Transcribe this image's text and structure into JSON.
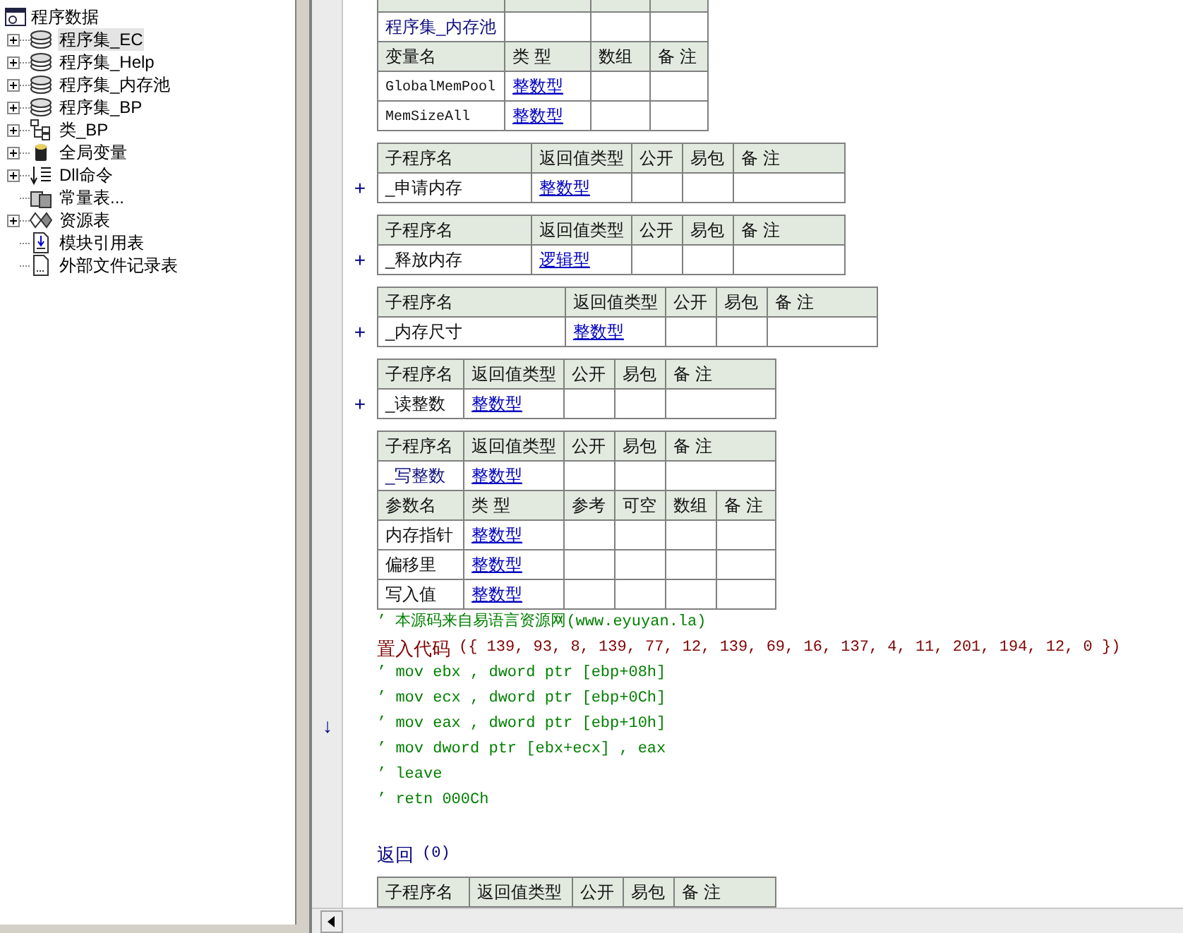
{
  "tree": {
    "root": {
      "text": "程序数据",
      "children": [
        {
          "text": "程序集_EC",
          "kind": "assembly",
          "expanded": false,
          "selected": true
        },
        {
          "text": "程序集_Help",
          "kind": "assembly",
          "expanded": false,
          "selected": false
        },
        {
          "text": "程序集_内存池",
          "kind": "assembly",
          "expanded": false,
          "selected": false
        },
        {
          "text": "程序集_BP",
          "kind": "assembly",
          "expanded": false,
          "selected": false
        },
        {
          "text": "类_BP",
          "kind": "class",
          "expanded": false,
          "selected": false
        },
        {
          "text": "全局变量",
          "kind": "global",
          "expanded": false,
          "selected": false
        },
        {
          "text": "Dll命令",
          "kind": "dll",
          "expanded": false,
          "selected": false
        },
        {
          "text": "常量表...",
          "kind": "constant",
          "selected": false
        },
        {
          "text": "资源表",
          "kind": "resource",
          "expanded": false,
          "selected": false
        },
        {
          "text": "模块引用表",
          "kind": "module",
          "selected": false
        },
        {
          "text": "外部文件记录表",
          "kind": "file",
          "selected": false
        }
      ]
    }
  },
  "editor": {
    "blocks": [
      {
        "kind": "table",
        "rows": [
          {
            "kind": "header_cut"
          },
          {
            "kind": "data",
            "cells": [
              {
                "text": "程序集_内存池",
                "kind": "name"
              },
              {
                "text": ""
              },
              {
                "text": ""
              },
              {
                "text": ""
              }
            ]
          },
          {
            "kind": "header",
            "cells": [
              {
                "text": "变量名"
              },
              {
                "text": "类 型"
              },
              {
                "text": "数组"
              },
              {
                "text": "备 注"
              }
            ]
          },
          {
            "kind": "data",
            "cells": [
              {
                "text": "GlobalMemPool",
                "kind": "mono"
              },
              {
                "text": "整数型",
                "kind": "link"
              },
              {
                "text": ""
              },
              {
                "text": ""
              }
            ]
          },
          {
            "kind": "data",
            "cells": [
              {
                "text": "MemSizeAll",
                "kind": "mono"
              },
              {
                "text": "整数型",
                "kind": "link"
              },
              {
                "text": ""
              },
              {
                "text": ""
              }
            ]
          }
        ]
      },
      {
        "kind": "table",
        "rows": [
          {
            "kind": "header",
            "cells": [
              {
                "text": "子程序名"
              },
              {
                "text": "返回值类型"
              },
              {
                "text": "公开"
              },
              {
                "text": "易包"
              },
              {
                "text": "备 注"
              }
            ]
          },
          {
            "kind": "data",
            "marker": "+",
            "cells": [
              {
                "text": "_申请内存",
                "kind": "plain"
              },
              {
                "text": "整数型",
                "kind": "link"
              },
              {
                "text": ""
              },
              {
                "text": ""
              },
              {
                "text": ""
              }
            ]
          }
        ]
      },
      {
        "kind": "table",
        "rows": [
          {
            "kind": "header",
            "cells": [
              {
                "text": "子程序名"
              },
              {
                "text": "返回值类型"
              },
              {
                "text": "公开"
              },
              {
                "text": "易包"
              },
              {
                "text": "备 注"
              }
            ]
          },
          {
            "kind": "data",
            "marker": "+",
            "cells": [
              {
                "text": "_释放内存",
                "kind": "plain"
              },
              {
                "text": "逻辑型",
                "kind": "link"
              },
              {
                "text": ""
              },
              {
                "text": ""
              },
              {
                "text": ""
              }
            ]
          }
        ]
      },
      {
        "kind": "table",
        "rows": [
          {
            "kind": "header",
            "cells": [
              {
                "text": "子程序名"
              },
              {
                "text": "返回值类型"
              },
              {
                "text": "公开"
              },
              {
                "text": "易包"
              },
              {
                "text": "备 注"
              }
            ]
          },
          {
            "kind": "data",
            "marker": "+",
            "cells": [
              {
                "text": "_内存尺寸",
                "kind": "plain"
              },
              {
                "text": "整数型",
                "kind": "link"
              },
              {
                "text": ""
              },
              {
                "text": ""
              },
              {
                "text": ""
              }
            ]
          }
        ]
      },
      {
        "kind": "table",
        "rows": [
          {
            "kind": "header",
            "cells": [
              {
                "text": "子程序名"
              },
              {
                "text": "返回值类型"
              },
              {
                "text": "公开"
              },
              {
                "text": "易包"
              },
              {
                "text": "备 注"
              }
            ]
          },
          {
            "kind": "data",
            "marker": "+",
            "cells": [
              {
                "text": "_读整数",
                "kind": "plain"
              },
              {
                "text": "整数型",
                "kind": "link"
              },
              {
                "text": ""
              },
              {
                "text": ""
              },
              {
                "text": ""
              }
            ]
          }
        ]
      },
      {
        "kind": "table",
        "rows": [
          {
            "kind": "header",
            "cells": [
              {
                "text": "子程序名"
              },
              {
                "text": "返回值类型"
              },
              {
                "text": "公开"
              },
              {
                "text": "易包"
              },
              {
                "text": "备 注"
              }
            ]
          },
          {
            "kind": "data",
            "cells": [
              {
                "text": "_写整数",
                "kind": "name"
              },
              {
                "text": "整数型",
                "kind": "link"
              },
              {
                "text": ""
              },
              {
                "text": ""
              },
              {
                "text": ""
              }
            ]
          }
        ]
      },
      {
        "kind": "param_table",
        "rows": [
          {
            "kind": "header",
            "cells": [
              {
                "text": "参数名"
              },
              {
                "text": "类 型"
              },
              {
                "text": "参考"
              },
              {
                "text": "可空"
              },
              {
                "text": "数组"
              },
              {
                "text": "备 注"
              }
            ]
          },
          {
            "kind": "data",
            "cells": [
              {
                "text": "内存指针",
                "kind": "plain"
              },
              {
                "text": "整数型",
                "kind": "link"
              },
              {
                "text": ""
              },
              {
                "text": ""
              },
              {
                "text": ""
              },
              {
                "text": ""
              }
            ]
          },
          {
            "kind": "data",
            "cells": [
              {
                "text": "偏移里",
                "kind": "plain"
              },
              {
                "text": "整数型",
                "kind": "link"
              },
              {
                "text": ""
              },
              {
                "text": ""
              },
              {
                "text": ""
              },
              {
                "text": ""
              }
            ]
          },
          {
            "kind": "data",
            "cells": [
              {
                "text": "写入值",
                "kind": "plain"
              },
              {
                "text": "整数型",
                "kind": "link"
              },
              {
                "text": ""
              },
              {
                "text": ""
              },
              {
                "text": ""
              },
              {
                "text": ""
              }
            ]
          }
        ]
      },
      {
        "kind": "comment",
        "text": "’ 本源码来自易语言资源网(www.eyuyan.la)"
      },
      {
        "kind": "call",
        "keyword": "置入代码",
        "args": "({ 139, 93, 8, 139, 77, 12, 139, 69, 16, 137, 4, 11, 201, 194, 12, 0 })"
      },
      {
        "kind": "comment",
        "text": "’ mov ebx , dword ptr [ebp+08h]"
      },
      {
        "kind": "comment",
        "text": "’ mov ecx , dword ptr [ebp+0Ch]"
      },
      {
        "kind": "comment",
        "text": "’ mov eax , dword ptr [ebp+10h]",
        "gutter": "↓"
      },
      {
        "kind": "comment",
        "text": "’ mov dword ptr [ebx+ecx] , eax"
      },
      {
        "kind": "comment",
        "text": "’ leave"
      },
      {
        "kind": "comment",
        "text": "’ retn 000Ch"
      },
      {
        "kind": "blank"
      },
      {
        "kind": "return",
        "keyword": "返回",
        "args": "(0)"
      },
      {
        "kind": "table",
        "rows": [
          {
            "kind": "header",
            "cells": [
              {
                "text": "子程序名"
              },
              {
                "text": "返回值类型"
              },
              {
                "text": "公开"
              },
              {
                "text": "易包"
              },
              {
                "text": "备 注"
              }
            ]
          },
          {
            "kind": "data_cut"
          }
        ]
      }
    ]
  }
}
